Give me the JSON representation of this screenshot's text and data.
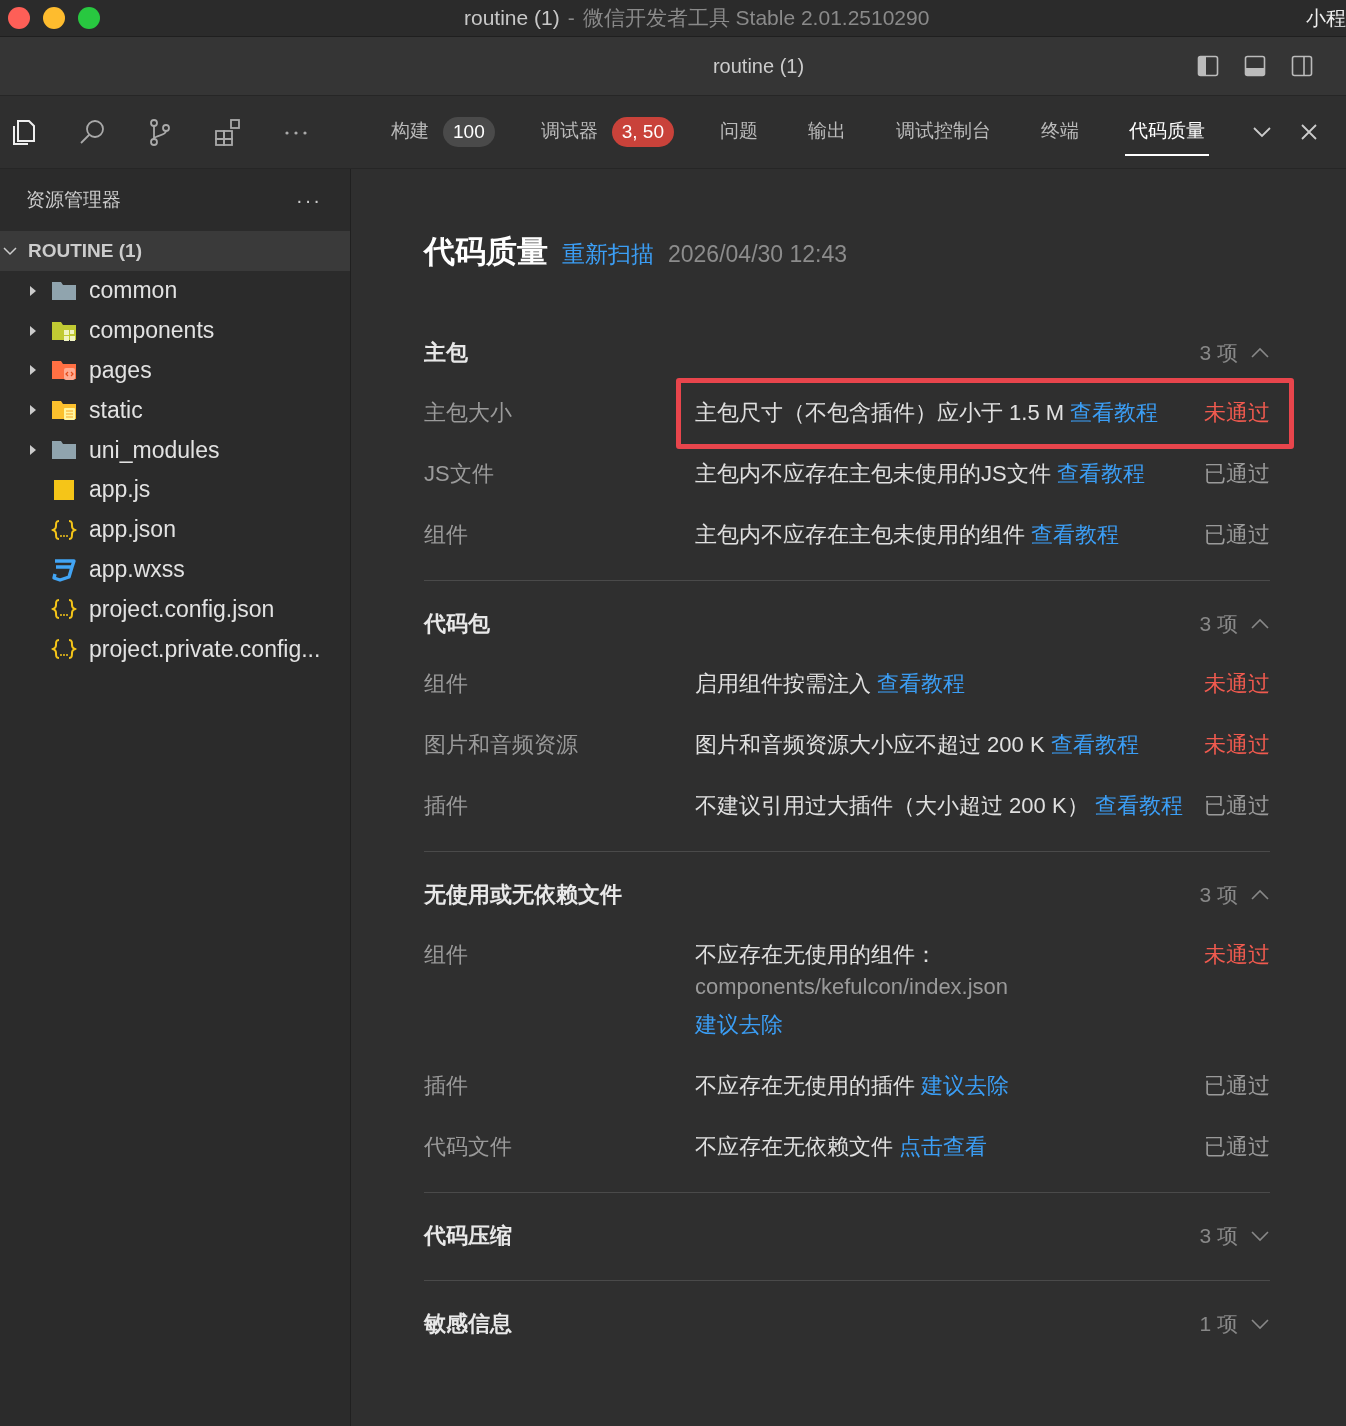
{
  "window": {
    "title": "routine (1)",
    "subtitle": "微信开发者工具 Stable 2.01.2510290",
    "separator": "-",
    "menu_cut": "小程"
  },
  "editor_title": "routine (1)",
  "panel_tabs": [
    {
      "label": "构建",
      "selected": false,
      "badge": "100",
      "color": "#4a4a4a"
    },
    {
      "label": "调试器",
      "selected": false,
      "badge": "3, 50",
      "color": "#c9423a"
    },
    {
      "label": "问题",
      "selected": false
    },
    {
      "label": "输出",
      "selected": false
    },
    {
      "label": "调试控制台",
      "selected": false
    },
    {
      "label": "终端",
      "selected": false
    },
    {
      "label": "代码质量",
      "selected": true
    }
  ],
  "sidebar": {
    "title": "资源管理器",
    "more": "···",
    "root": {
      "label": "ROUTINE (1)",
      "expanded": true,
      "children": [
        {
          "label": "common",
          "kind": "folder",
          "expanded": false
        },
        {
          "label": "components",
          "kind": "widgets",
          "expanded": false
        },
        {
          "label": "pages",
          "kind": "code",
          "expanded": false
        },
        {
          "label": "static",
          "kind": "assets",
          "expanded": false
        },
        {
          "label": "uni_modules",
          "kind": "folder",
          "expanded": false
        },
        {
          "label": "app.js",
          "kind": "script"
        },
        {
          "label": "app.json",
          "kind": "data"
        },
        {
          "label": "app.wxss",
          "kind": "style"
        },
        {
          "label": "project.config.json",
          "kind": "data"
        },
        {
          "label": "project.private.config...",
          "kind": "data"
        }
      ]
    }
  },
  "report": {
    "title": "代码质量",
    "rescan": "重新扫描",
    "time": "2026/04/30 12:43",
    "sections": [
      {
        "title": "主包",
        "count": "3 项",
        "expanded": true,
        "rows": [
          {
            "name": "主包大小",
            "text": "主包尺寸（不包含插件）应小于 1.5 M",
            "link": "查看教程",
            "status": "未通过",
            "passed": false,
            "highlighted": true
          },
          {
            "name": "JS文件",
            "text": "主包内不应存在主包未使用的JS文件",
            "link": "查看教程",
            "status": "已通过",
            "passed": true,
            "highlighted": false
          },
          {
            "name": "组件",
            "text": "主包内不应存在主包未使用的组件",
            "link": "查看教程",
            "status": "已通过",
            "passed": true,
            "highlighted": false
          }
        ]
      },
      {
        "title": "代码包",
        "count": "3 项",
        "expanded": true,
        "rows": [
          {
            "name": "组件",
            "text": "启用组件按需注入",
            "link": "查看教程",
            "status": "未通过",
            "passed": false,
            "highlighted": false
          },
          {
            "name": "图片和音频资源",
            "text": "图片和音频资源大小应不超过 200 K",
            "link": "查看教程",
            "status": "未通过",
            "passed": false,
            "highlighted": false
          },
          {
            "name": "插件",
            "text": "不建议引用过大插件（大小超过 200 K）",
            "link": "查看教程",
            "status": "已通过",
            "passed": true,
            "highlighted": false
          }
        ]
      },
      {
        "title": "无使用或无依赖文件",
        "count": "3 项",
        "expanded": true,
        "rows": [
          {
            "name": "组件",
            "text": "不应存在无使用的组件：",
            "path": "components/kefulcon/index.json",
            "link": "建议去除",
            "status": "未通过",
            "passed": false,
            "highlighted": false
          },
          {
            "name": "插件",
            "text": "不应存在无使用的插件",
            "link": "建议去除",
            "status": "已通过",
            "passed": true,
            "highlighted": false
          },
          {
            "name": "代码文件",
            "text": "不应存在无依赖文件",
            "link": "点击查看",
            "status": "已通过",
            "passed": true,
            "highlighted": false
          }
        ]
      },
      {
        "title": "代码压缩",
        "count": "3 项",
        "expanded": false
      },
      {
        "title": "敏感信息",
        "count": "1 项",
        "expanded": false
      }
    ]
  }
}
